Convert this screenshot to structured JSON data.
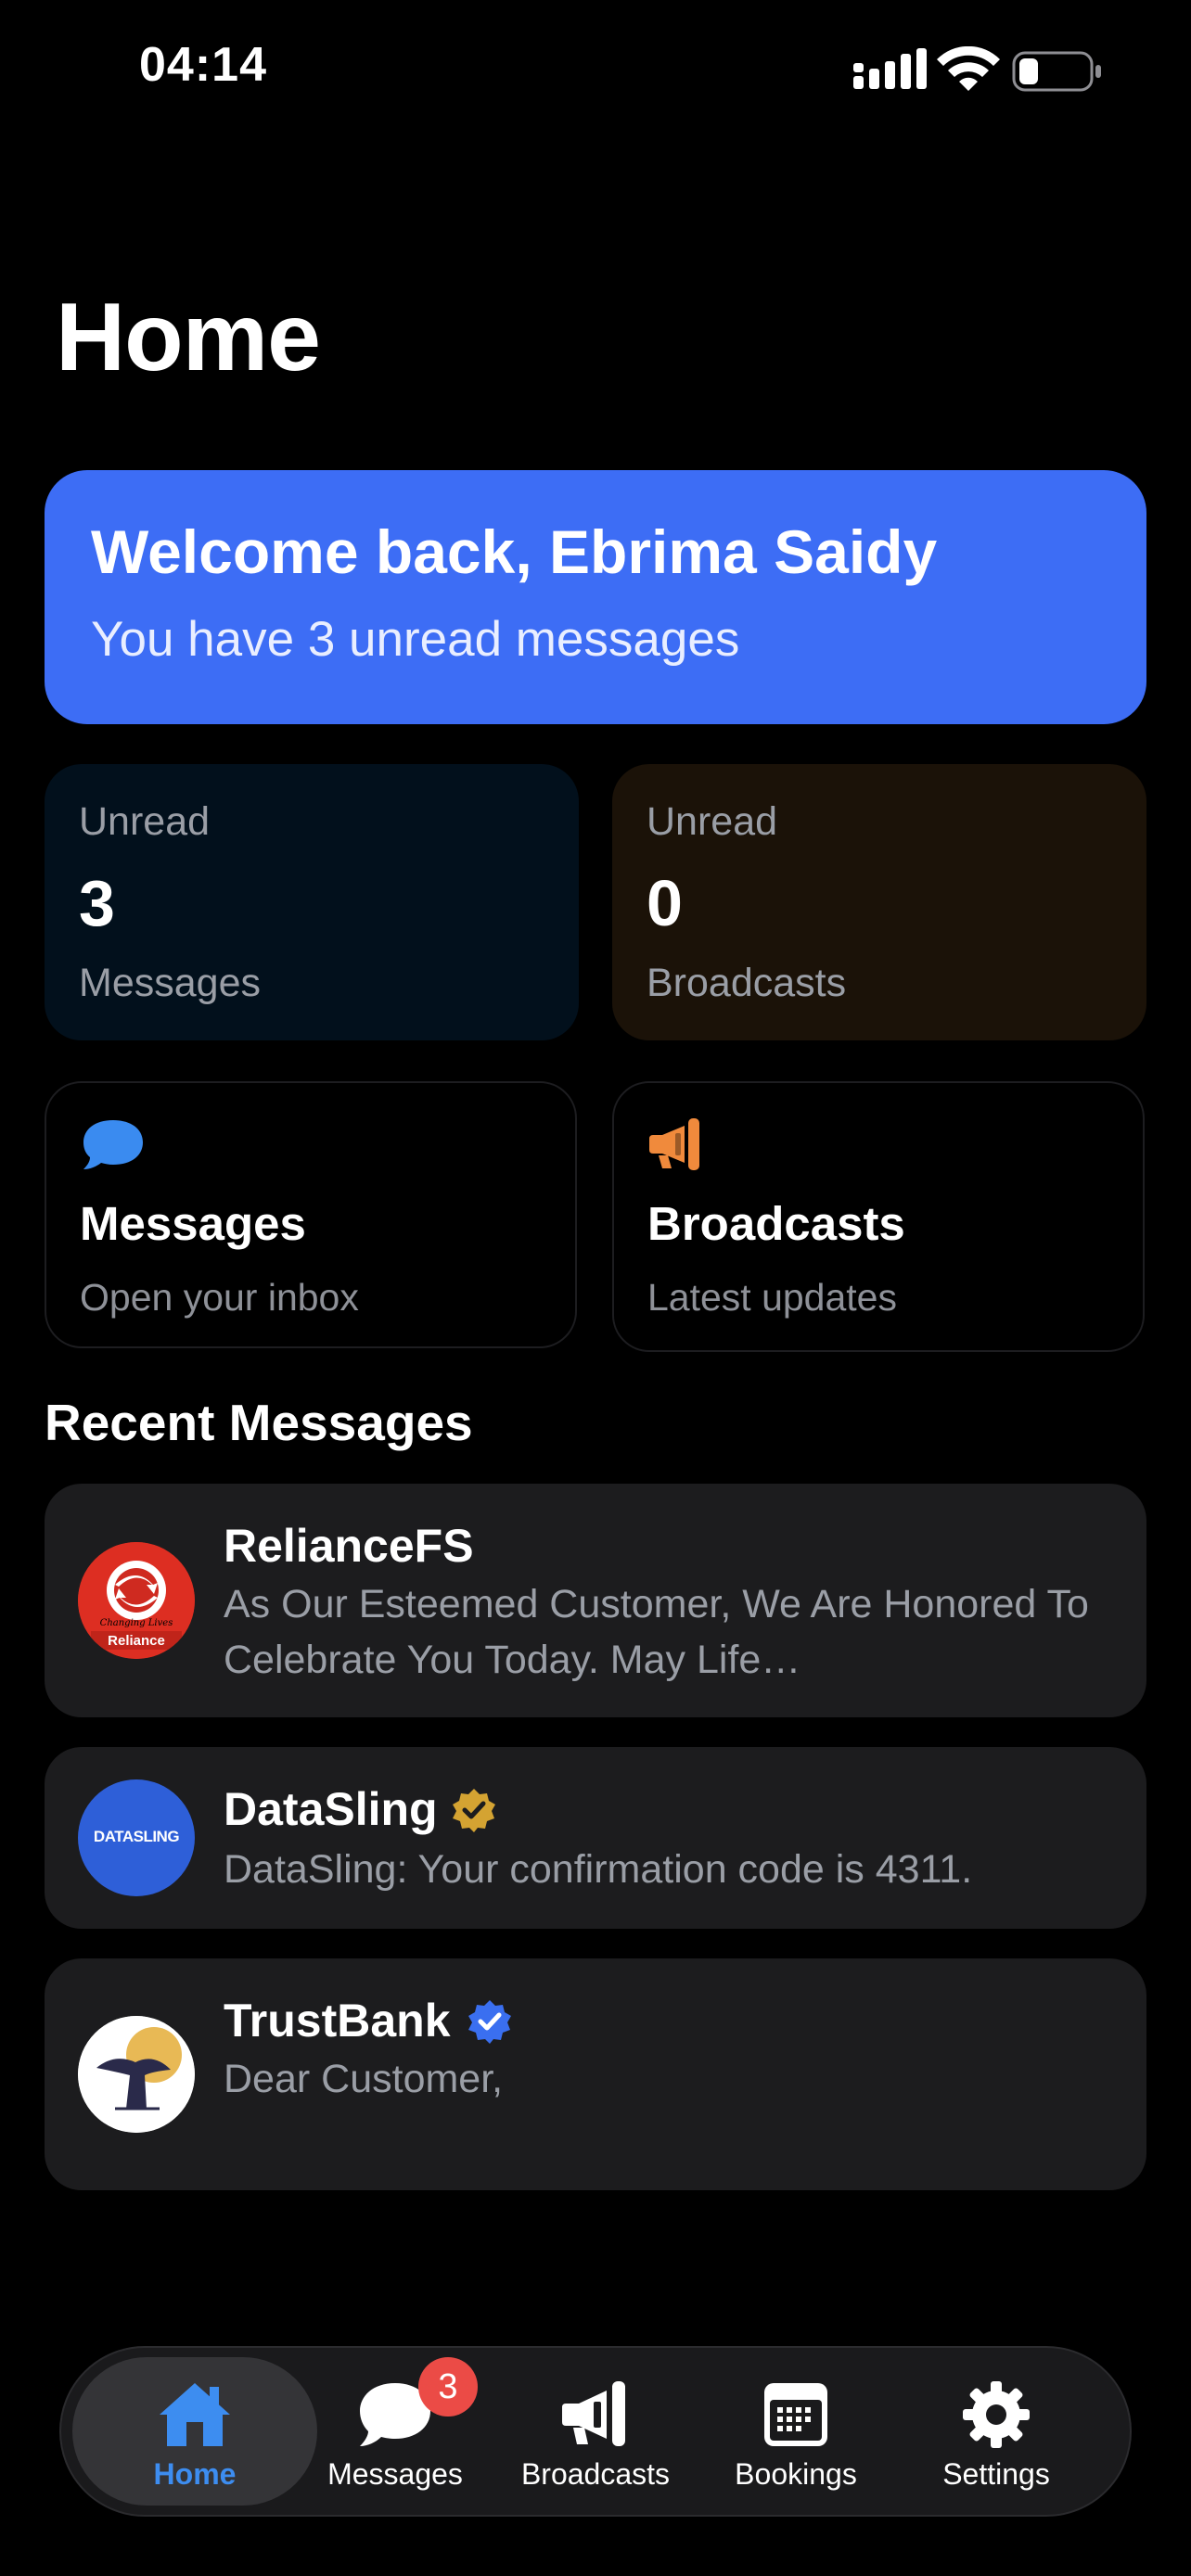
{
  "status_bar": {
    "time": "04:14"
  },
  "page": {
    "title": "Home"
  },
  "welcome": {
    "title": "Welcome back, Ebrima Saidy",
    "subtitle": "You have 3 unread messages"
  },
  "stats": [
    {
      "label": "Unread",
      "value": "3",
      "caption": "Messages"
    },
    {
      "label": "Unread",
      "value": "0",
      "caption": "Broadcasts"
    }
  ],
  "actions": [
    {
      "title": "Messages",
      "subtitle": "Open your inbox",
      "icon": "chat-bubble-icon"
    },
    {
      "title": "Broadcasts",
      "subtitle": "Latest updates",
      "icon": "megaphone-icon"
    }
  ],
  "recent": {
    "title": "Recent Messages",
    "items": [
      {
        "sender": "RelianceFS",
        "preview": "As Our Esteemed Customer, We Are Honored To Celebrate You Today. May Life…",
        "avatar_text_top": "Changing Lives",
        "avatar_text_bottom": "Reliance",
        "verified": false
      },
      {
        "sender": "DataSling",
        "preview": "DataSling: Your confirmation code is 4311.",
        "avatar_text": "DATASLING",
        "verified": true,
        "verified_color": "#d4a332"
      },
      {
        "sender": "TrustBank",
        "preview": "Dear Customer,",
        "verified": true,
        "verified_color": "#3a6ff0"
      }
    ]
  },
  "tabs": [
    {
      "label": "Home",
      "icon": "house-icon",
      "active": true
    },
    {
      "label": "Messages",
      "icon": "chat-bubble-icon",
      "badge": "3"
    },
    {
      "label": "Broadcasts",
      "icon": "megaphone-icon"
    },
    {
      "label": "Bookings",
      "icon": "calendar-icon"
    },
    {
      "label": "Settings",
      "icon": "gear-icon"
    }
  ],
  "colors": {
    "accent": "#3d6df5",
    "tab_active": "#3d8df0",
    "badge": "#eb4b46",
    "broadcast_orange": "#f08a3c"
  }
}
